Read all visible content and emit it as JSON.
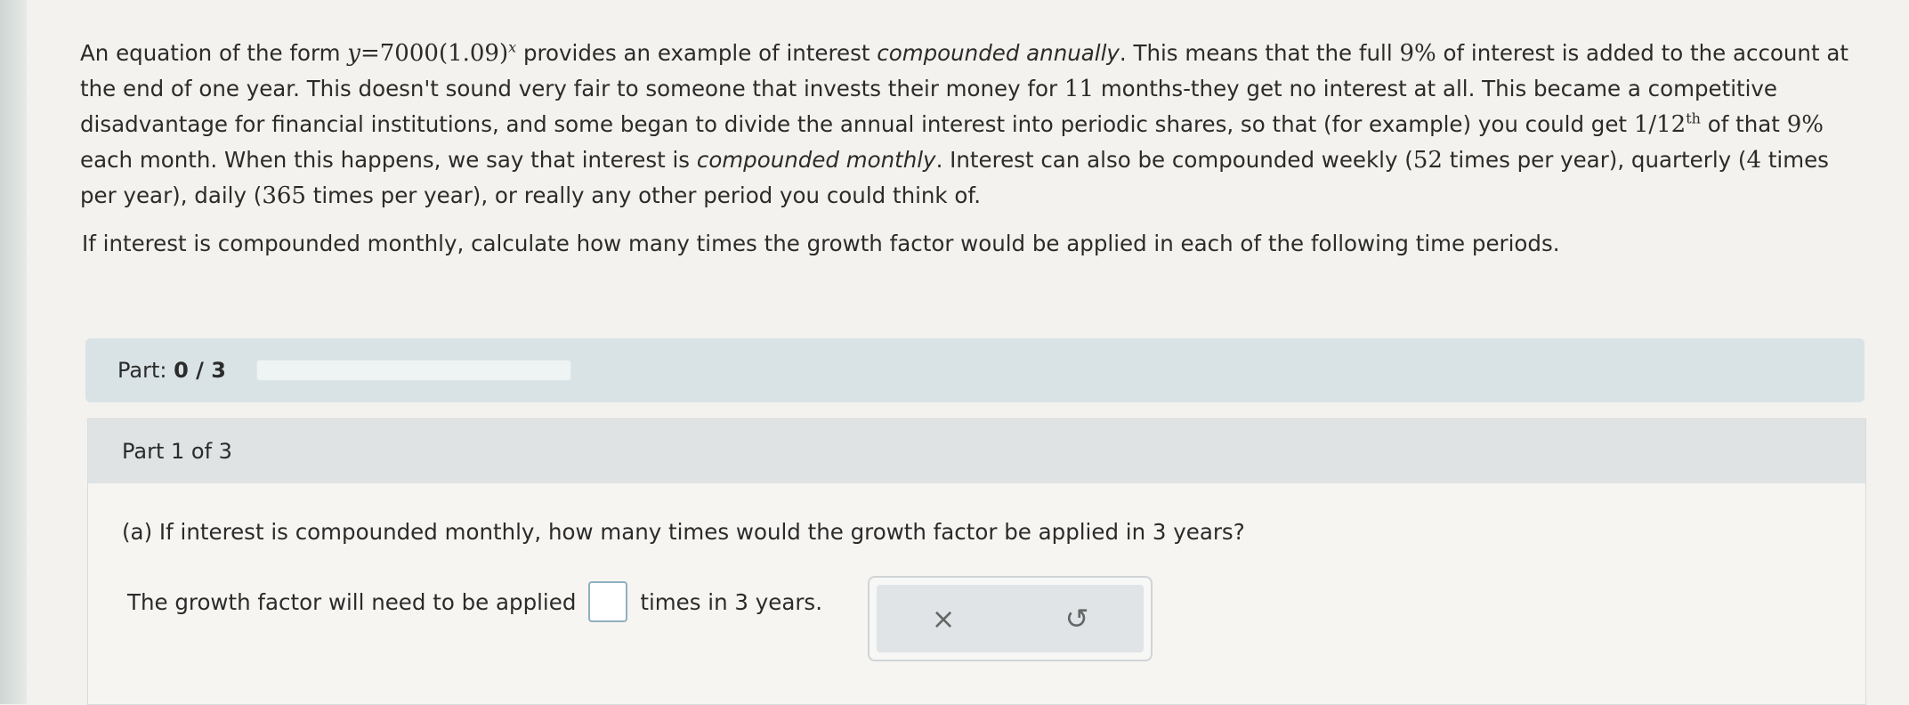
{
  "intro": {
    "p1": "An equation of the form",
    "eq_lhs": "y",
    "eq_eq": "=7000(1.09)",
    "eq_exp": "x",
    "p2": "provides an example of interest",
    "p2_em": "compounded annually",
    "p3": ". This means that the full",
    "rate": "9%",
    "p4": "of interest is added to the account at the end of one year. This doesn't sound very fair to someone that invests their money for",
    "months": "11",
    "p5": "months-they get no interest at all. This became a competitive disadvantage for financial institutions, and some began to divide the annual interest into periodic shares, so that (for example) you could get",
    "frac": "1/12",
    "frac_sup": "th",
    "p6": "of that",
    "rate2": "9%",
    "p7": "each month. When this happens, we say that interest is",
    "p7_em": "compounded monthly",
    "p8": ". Interest can also be compounded weekly (",
    "n52": "52",
    "p9": "times per year), quarterly (",
    "n4": "4",
    "p10": "times per year), daily (",
    "n365": "365",
    "p11": "times per year), or really any other period you could think of."
  },
  "question": "If interest is compounded monthly, calculate how many times the growth factor would be applied in each of the following time periods.",
  "part_bar": {
    "label": "Part:",
    "progress_text": "0 / 3",
    "progress": 0
  },
  "part": {
    "header": "Part 1 of 3",
    "question": "(a) If interest is compounded monthly, how many times would the growth factor be applied in 3 years?",
    "answer_prefix": "The growth factor will need to be applied",
    "answer_suffix": "times in 3 years.",
    "clear_icon": "×",
    "undo_icon": "↺"
  }
}
